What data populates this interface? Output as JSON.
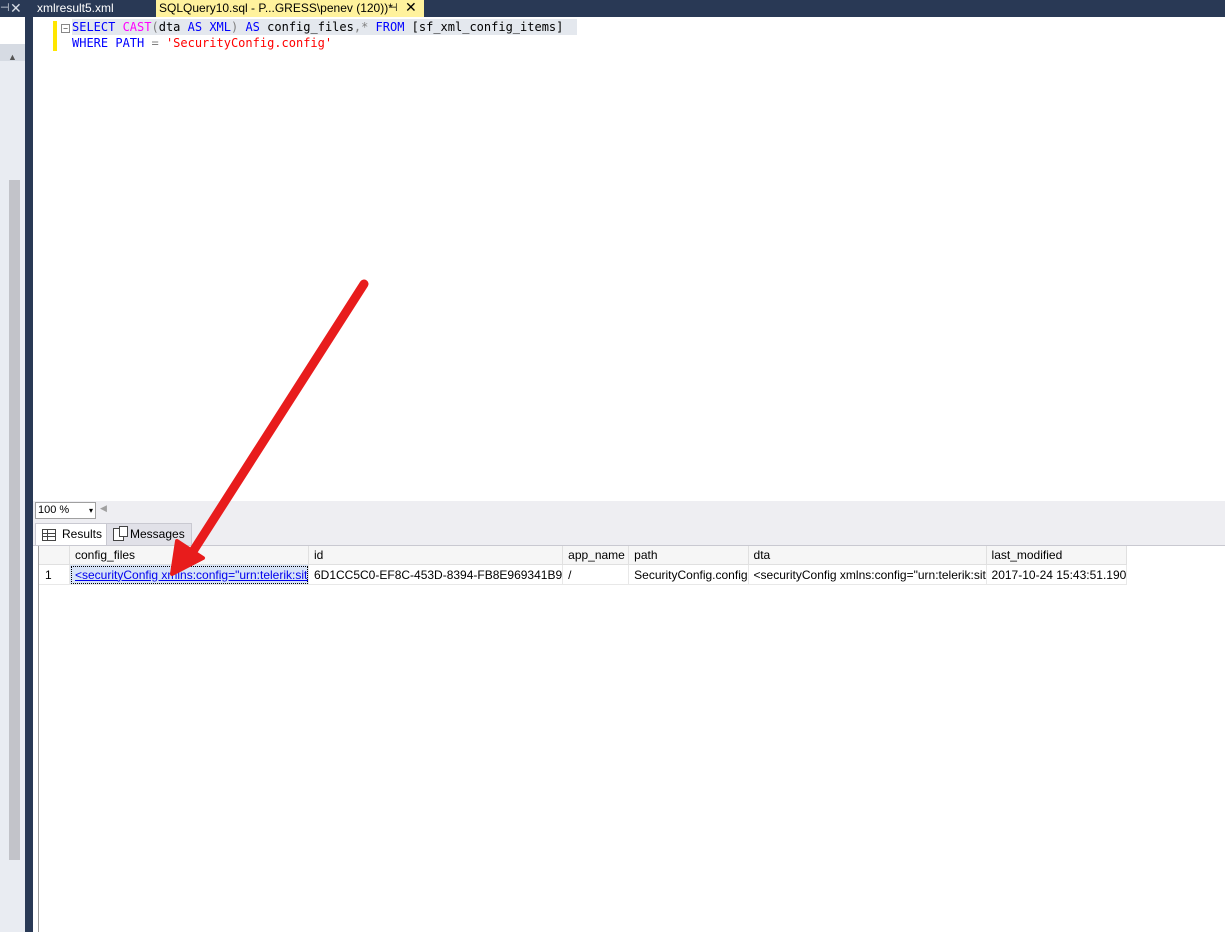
{
  "tabs": {
    "xml_tab": "xmlresult5.xml",
    "sql_tab": "SQLQuery10.sql - P...GRESS\\penev (120))*",
    "pin_glyph": "⊣",
    "close_glyph": "✕"
  },
  "editor": {
    "line1": {
      "select": "SELECT ",
      "cast": "CAST",
      "paren_open": "(",
      "dta": "dta ",
      "as1": "AS ",
      "xml": "XML",
      "paren_close": ") ",
      "as2": "AS ",
      "alias": "config_files",
      "comma_star": ",* ",
      "from": "FROM ",
      "table": "[sf_xml_config_items]"
    },
    "line2": {
      "where": "WHERE ",
      "path": "PATH ",
      "eq": "= ",
      "value": "'SecurityConfig.config'"
    },
    "collapse_glyph": "−"
  },
  "zoom": {
    "value": "100 %",
    "arrow": "▾",
    "scroll_left": "◀"
  },
  "result_tabs": {
    "results": "Results",
    "messages": "Messages"
  },
  "grid": {
    "columns": [
      "config_files",
      "id",
      "app_name",
      "path",
      "dta",
      "last_modified"
    ],
    "rows": [
      {
        "rownum": "1",
        "config_files": "<securityConfig xmlns:config=\"urn:telerik:sitefi...",
        "id": "6D1CC5C0-EF8C-453D-8394-FB8E969341B9",
        "app_name": "/",
        "path": "SecurityConfig.config",
        "dta": "<securityConfig xmlns:config=\"urn:telerik:sitefi...",
        "last_modified": "2017-10-24 15:43:51.190"
      }
    ]
  },
  "colors": {
    "tabbar": "#293955",
    "active_tab": "#fff29d",
    "keyword": "#0000ff",
    "function": "#ff00ff",
    "string": "#ff0000",
    "annotation_arrow": "#e81c1c"
  },
  "scrollbar": {
    "up_glyph": "▲"
  }
}
